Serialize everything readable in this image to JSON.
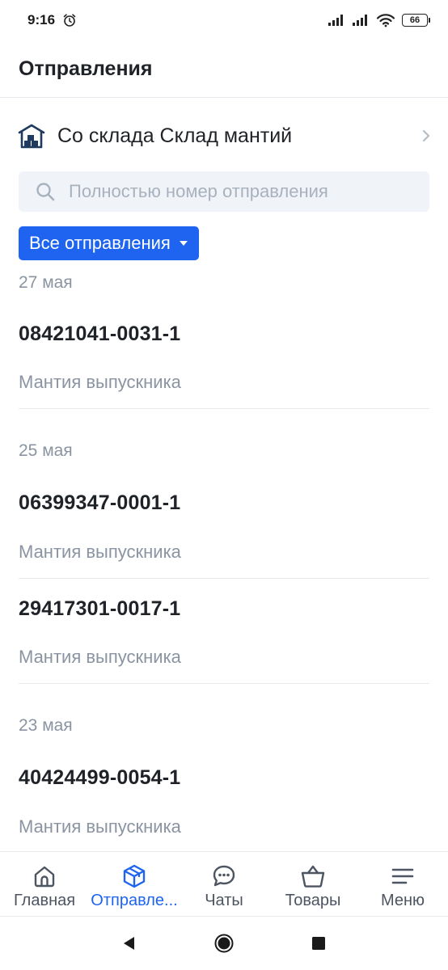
{
  "status_bar": {
    "time": "9:16",
    "battery": "66"
  },
  "header": {
    "title": "Отправления"
  },
  "warehouse": {
    "label": "Со склада Склад мантий"
  },
  "search": {
    "placeholder": "Полностью номер отправления",
    "value": ""
  },
  "filter": {
    "label": "Все отправления"
  },
  "groups": [
    {
      "date": "27 мая",
      "items": [
        {
          "number": "08421041-0031-1",
          "product": "Мантия выпускника"
        }
      ]
    },
    {
      "date": "25 мая",
      "items": [
        {
          "number": "06399347-0001-1",
          "product": "Мантия выпускника"
        },
        {
          "number": "29417301-0017-1",
          "product": "Мантия выпускника"
        }
      ]
    },
    {
      "date": "23 мая",
      "items": [
        {
          "number": "40424499-0054-1",
          "product": "Мантия выпускника"
        }
      ]
    }
  ],
  "bottom_nav": {
    "items": [
      {
        "label": "Главная",
        "icon": "home-icon",
        "active": false
      },
      {
        "label": "Отправле...",
        "icon": "box-icon",
        "active": true
      },
      {
        "label": "Чаты",
        "icon": "chat-icon",
        "active": false
      },
      {
        "label": "Товары",
        "icon": "basket-icon",
        "active": false
      },
      {
        "label": "Меню",
        "icon": "menu-icon",
        "active": false
      }
    ]
  },
  "colors": {
    "accent": "#1e64f0",
    "text": "#1f2328",
    "muted": "#8a94a2",
    "divider": "#e6e9ee"
  }
}
